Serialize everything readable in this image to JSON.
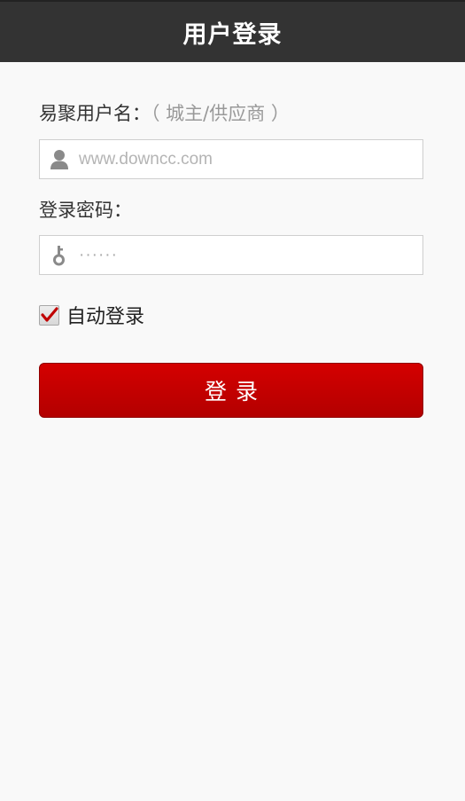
{
  "header": {
    "title": "用户登录"
  },
  "form": {
    "username_label": "易聚用户名：",
    "username_hint": "（ 城主/供应商 ）",
    "username_placeholder": "www.downcc.com",
    "username_icon": "user-icon",
    "password_label": "登录密码：",
    "password_value": "······",
    "password_icon": "key-icon",
    "remember_label": "自动登录",
    "remember_checked": true,
    "login_button_label": "登录"
  },
  "colors": {
    "header_bg": "#333333",
    "button_red": "#cc0000",
    "checkmark": "#c00000"
  }
}
